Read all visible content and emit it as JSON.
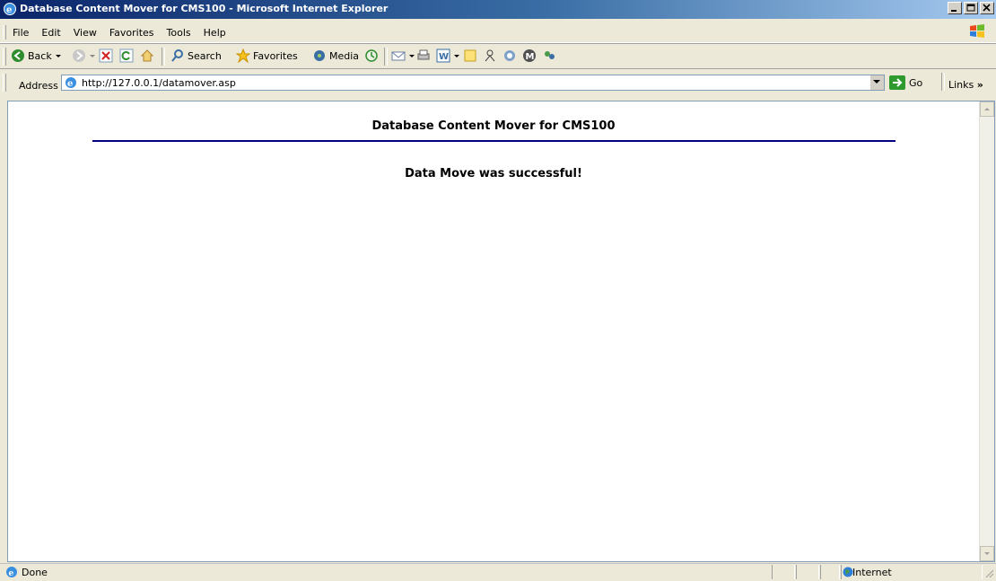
{
  "window": {
    "title": "Database Content Mover for CMS100 - Microsoft Internet Explorer"
  },
  "menu": [
    "File",
    "Edit",
    "View",
    "Favorites",
    "Tools",
    "Help"
  ],
  "toolbar": {
    "back_label": "Back",
    "search_label": "Search",
    "favorites_label": "Favorites",
    "media_label": "Media"
  },
  "address": {
    "label": "Address",
    "url": "http://127.0.0.1/datamover.asp",
    "go_label": "Go",
    "links_label": "Links"
  },
  "page": {
    "title": "Database Content Mover for CMS100",
    "message": "Data Move was successful!",
    "rule_color": "#000080"
  },
  "status": {
    "text": "Done",
    "zone": "Internet"
  },
  "colors": {
    "titlebar": "#0a246a",
    "chrome": "#ece9d8"
  }
}
